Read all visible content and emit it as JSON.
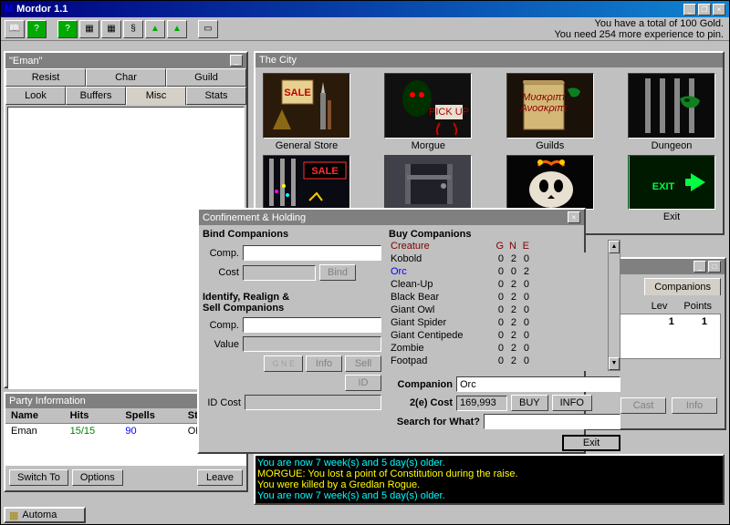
{
  "app": {
    "title": "Mordor 1.1"
  },
  "status": {
    "line1": "You have a total of 100 Gold.",
    "line2": "You need 254 more experience to pin."
  },
  "char_panel": {
    "title": "\"Eman\"",
    "tabs_top": [
      "Resist",
      "Char",
      "Guild"
    ],
    "tabs_bot": [
      "Look",
      "Buffers",
      "Misc",
      "Stats"
    ],
    "active_tab": "Misc"
  },
  "city": {
    "title": "The City",
    "items": [
      "General Store",
      "Morgue",
      "Guilds",
      "Dungeon"
    ],
    "exit": "Exit"
  },
  "confine": {
    "title": "Confinement & Holding",
    "bind_header": "Bind Companions",
    "comp_label": "Comp.",
    "cost_label": "Cost",
    "bind_btn": "Bind",
    "ident_header": "Identify, Realign &\nSell Companions",
    "value_label": "Value",
    "info_btn": "Info",
    "sell_btn": "Sell",
    "id_btn": "ID",
    "idcost_label": "ID Cost",
    "buy_header": "Buy Companions",
    "cols": {
      "creature": "Creature",
      "g": "G",
      "n": "N",
      "e": "E"
    },
    "creatures": [
      {
        "name": "Kobold",
        "g": 0,
        "n": 2,
        "e": 0
      },
      {
        "name": "Orc",
        "g": 0,
        "n": 0,
        "e": 2
      },
      {
        "name": "Clean-Up",
        "g": 0,
        "n": 2,
        "e": 0
      },
      {
        "name": "Black Bear",
        "g": 0,
        "n": 2,
        "e": 0
      },
      {
        "name": "Giant Owl",
        "g": 0,
        "n": 2,
        "e": 0
      },
      {
        "name": "Giant Spider",
        "g": 0,
        "n": 2,
        "e": 0
      },
      {
        "name": "Giant Centipede",
        "g": 0,
        "n": 2,
        "e": 0
      },
      {
        "name": "Zombie",
        "g": 0,
        "n": 2,
        "e": 0
      },
      {
        "name": "Footpad",
        "g": 0,
        "n": 2,
        "e": 0
      }
    ],
    "selected": 1,
    "companion_label": "Companion",
    "companion_value": "Orc",
    "cost2_label": "2(e) Cost",
    "cost2_value": "169,993",
    "buy_btn": "BUY",
    "info2_btn": "INFO",
    "search_label": "Search for What?",
    "exit_btn": "Exit"
  },
  "party": {
    "title": "Party Information",
    "cols": [
      "Name",
      "Hits",
      "Spells",
      "Status"
    ],
    "row": {
      "name": "Eman",
      "hits": "15/15",
      "spells": "90",
      "status": "OK"
    },
    "switch": "Switch To",
    "options": "Options",
    "leave": "Leave"
  },
  "companions": {
    "tab": "Companions",
    "cols": {
      "lev": "Lev",
      "points": "Points"
    },
    "lev": "1",
    "points": "1",
    "cast": "Cast",
    "info": "Info"
  },
  "log": {
    "lines": [
      "You are now 7 week(s) and 5 day(s) older.",
      "MORGUE: You lost a point of Constitution during the raise.",
      "You were killed by a Gredlan Rogue.",
      "You are now 7 week(s) and 5 day(s) older."
    ]
  },
  "taskbar": {
    "item": "Automa"
  }
}
